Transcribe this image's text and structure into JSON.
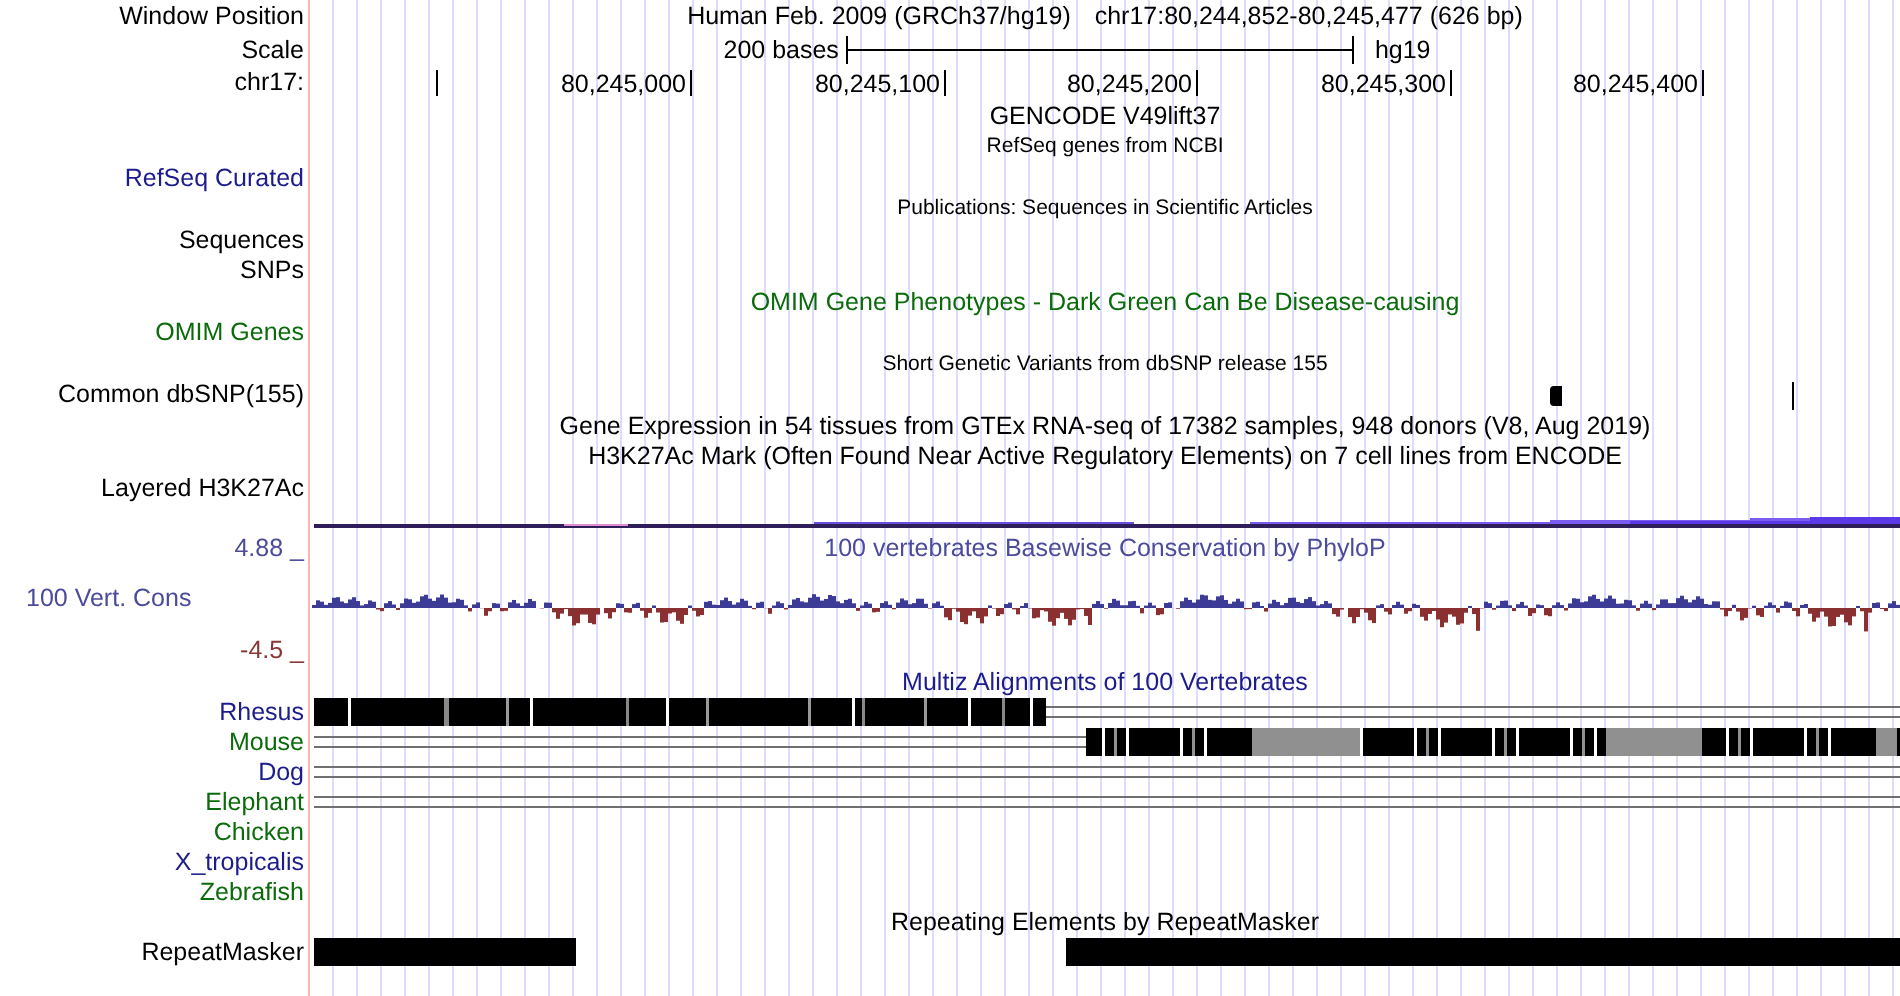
{
  "header": {
    "label": "Window Position",
    "assembly": "Human Feb. 2009 (GRCh37/hg19)",
    "position": "chr17:80,244,852-80,245,477 (626 bp)"
  },
  "scale": {
    "label": "Scale",
    "length": "200 bases",
    "db": "hg19"
  },
  "ruler": {
    "label": "chr17:",
    "ticks": [
      "80,245,000",
      "80,245,100",
      "80,245,200",
      "80,245,300",
      "80,245,400"
    ]
  },
  "tracks": [
    {
      "kind": "title",
      "title": "GENCODE V49lift37",
      "color": "#000000"
    },
    {
      "kind": "subtitle",
      "title": "RefSeq genes from NCBI",
      "color": "#000000"
    },
    {
      "kind": "label",
      "label": "RefSeq Curated",
      "color": "#1c1c8c"
    },
    {
      "kind": "subtitle",
      "title": "Publications: Sequences in Scientific Articles",
      "color": "#000000"
    },
    {
      "kind": "label",
      "label": "Sequences",
      "color": "#000000"
    },
    {
      "kind": "label",
      "label": "SNPs",
      "color": "#000000"
    },
    {
      "kind": "title",
      "title": "OMIM Gene Phenotypes - Dark Green Can Be Disease-causing",
      "color": "#0b6b0b"
    },
    {
      "kind": "label",
      "label": "OMIM Genes",
      "color": "#0b6b0b"
    },
    {
      "kind": "subtitle",
      "title": "Short Genetic Variants from dbSNP release 155",
      "color": "#000000"
    },
    {
      "kind": "snps",
      "label": "Common dbSNP(155)",
      "color": "#000000"
    },
    {
      "kind": "title",
      "title": "Gene Expression in 54 tissues from GTEx RNA-seq of 17382 samples, 948 donors (V8, Aug 2019)",
      "color": "#000000"
    },
    {
      "kind": "title",
      "title": "H3K27Ac Mark (Often Found Near Active Regulatory Elements) on 7 cell lines from ENCODE",
      "color": "#000000"
    },
    {
      "kind": "label",
      "label": "Layered H3K27Ac",
      "color": "#000000"
    },
    {
      "kind": "layered"
    },
    {
      "kind": "conservation",
      "title": "100 vertebrates Basewise Conservation by PhyloP",
      "label": "100 Vert. Cons",
      "max": "4.88 _",
      "min": "-4.5 _",
      "color": "#4b4b9b"
    },
    {
      "kind": "title",
      "title": "Multiz Alignments of 100 Vertebrates",
      "color": "#1c1c8c"
    },
    {
      "kind": "species",
      "label": "Rhesus",
      "color": "#1c1c8c"
    },
    {
      "kind": "species",
      "label": "Mouse",
      "color": "#0b6b0b"
    },
    {
      "kind": "species",
      "label": "Dog",
      "color": "#1c1c8c"
    },
    {
      "kind": "species",
      "label": "Elephant",
      "color": "#0b6b0b"
    },
    {
      "kind": "species",
      "label": "Chicken",
      "color": "#0b6b0b"
    },
    {
      "kind": "species",
      "label": "X_tropicalis",
      "color": "#1c1c8c"
    },
    {
      "kind": "species",
      "label": "Zebrafish",
      "color": "#0b6b0b"
    },
    {
      "kind": "title",
      "title": "Repeating Elements by RepeatMasker",
      "color": "#000000"
    },
    {
      "kind": "repeat",
      "label": "RepeatMasker",
      "color": "#000000"
    }
  ]
}
